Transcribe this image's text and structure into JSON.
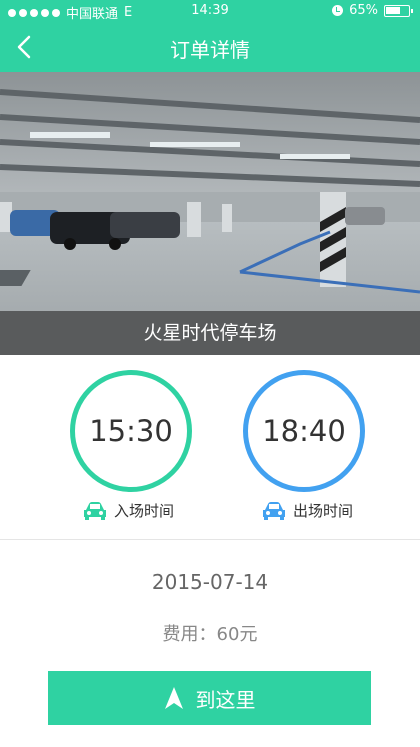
{
  "status_bar": {
    "carrier": "中国联通",
    "network": "E",
    "time": "14:39",
    "battery": "65%"
  },
  "nav": {
    "title": "订单详情",
    "back_icon": "chevron-left-icon"
  },
  "hero": {
    "caption": "火星时代停车场"
  },
  "times": {
    "entry_time": "15:30",
    "entry_label": "入场时间",
    "exit_time": "18:40",
    "exit_label": "出场时间"
  },
  "details": {
    "date": "2015-07-14",
    "fee": "费用：60元"
  },
  "action": {
    "go_label": "到这里",
    "icon": "navigation-arrow-icon"
  },
  "colors": {
    "accent": "#2fd2a2",
    "exit_ring": "#42a1f0"
  }
}
